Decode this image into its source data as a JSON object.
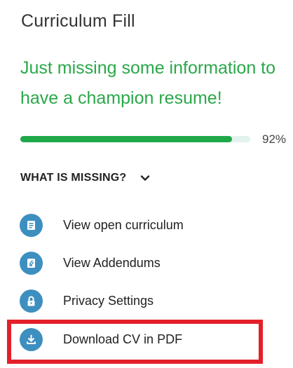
{
  "panel": {
    "title": "Curriculum Fill",
    "subtitle": "Just missing some information to have a champion resume!"
  },
  "progress": {
    "value": 0.92,
    "label": "92%",
    "fill_color": "#1fa84a",
    "track_color": "#e1f3ec"
  },
  "missing": {
    "header": "WHAT IS MISSING?",
    "toggle_icon": "chevron-down-icon"
  },
  "menu": {
    "icon_color": "#3d8fc0",
    "items": [
      {
        "label": "View open curriculum",
        "icon": "document-icon"
      },
      {
        "label": "View Addendums",
        "icon": "attachment-document-icon"
      },
      {
        "label": "Privacy Settings",
        "icon": "lock-icon"
      },
      {
        "label": "Download CV in PDF",
        "icon": "download-icon"
      }
    ]
  },
  "highlight": {
    "color": "#e3202a",
    "target": "Download CV in PDF"
  }
}
